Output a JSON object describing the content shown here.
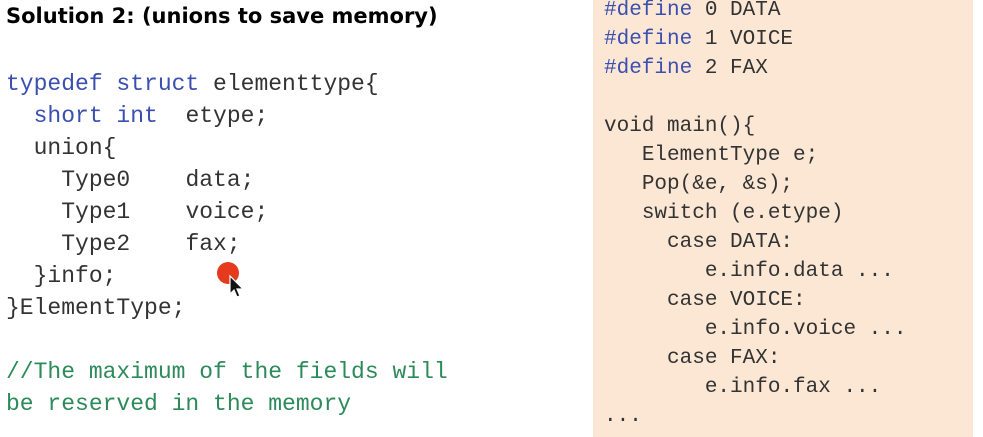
{
  "title": "Solution 2: (unions to save memory)",
  "left_code": {
    "l1_kw": "typedef struct",
    "l1_rest": " elementtype{",
    "l2_kw": "short int",
    "l2_rest": "  etype;",
    "l3": "union{",
    "l4_type": "Type0",
    "l4_name": "data;",
    "l5_type": "Type1",
    "l5_name": "voice;",
    "l6_type": "Type2",
    "l6_name": "fax;",
    "l7": "}info;",
    "l8": "}ElementType;",
    "c1": "//The maximum of the fields will",
    "c2": "be reserved in the memory"
  },
  "right_code": {
    "d1_kw": "#define",
    "d1_rest": " 0 DATA",
    "d2_kw": "#define",
    "d2_rest": " 1 VOICE",
    "d3_kw": "#define",
    "d3_rest": " 2 FAX",
    "m1": "void main(){",
    "m2": "ElementType e;",
    "m3": "Pop(&e, &s);",
    "m4": "switch (e.etype)",
    "m5": "case DATA:",
    "m6": "e.info.data ...",
    "m7": "case VOICE:",
    "m8": "e.info.voice ...",
    "m9": "case FAX:",
    "m10": "e.info.fax ...",
    "m11": "..."
  },
  "colors": {
    "keyword": "#3a4fb0",
    "comment": "#2d8a5a",
    "panel": "#fbe7d3",
    "pointer_dot": "#e63a1f"
  }
}
